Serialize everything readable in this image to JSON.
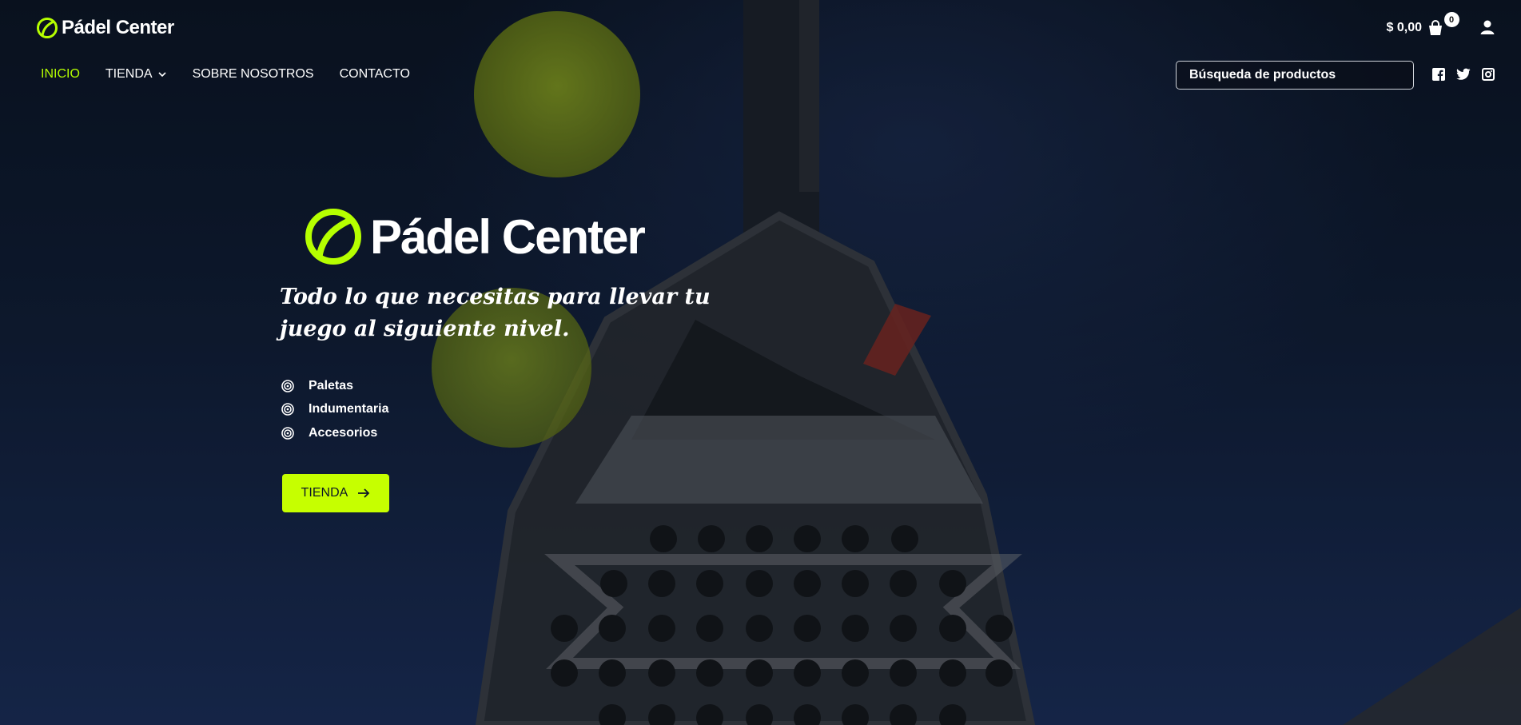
{
  "brand": {
    "name": "Pádel Center",
    "accent": "#b6ff00",
    "cta_color": "#c6ff00"
  },
  "nav": {
    "items": [
      {
        "label": "INICIO"
      },
      {
        "label": "TIENDA"
      },
      {
        "label": "SOBRE NOSOTROS"
      },
      {
        "label": "CONTACTO"
      }
    ]
  },
  "cart": {
    "total": "$ 0,00",
    "count": "0",
    "icon": "shopping-bag-icon"
  },
  "account": {
    "icon": "user-icon"
  },
  "search": {
    "placeholder": "Búsqueda de productos"
  },
  "social": {
    "icons": [
      "facebook-icon",
      "twitter-icon",
      "instagram-icon"
    ]
  },
  "hero": {
    "tagline": "Todo lo que necesitas para llevar tu juego al siguiente nivel.",
    "features": [
      "Paletas",
      "Indumentaria",
      "Accesorios"
    ],
    "cta_label": "TIENDA"
  }
}
